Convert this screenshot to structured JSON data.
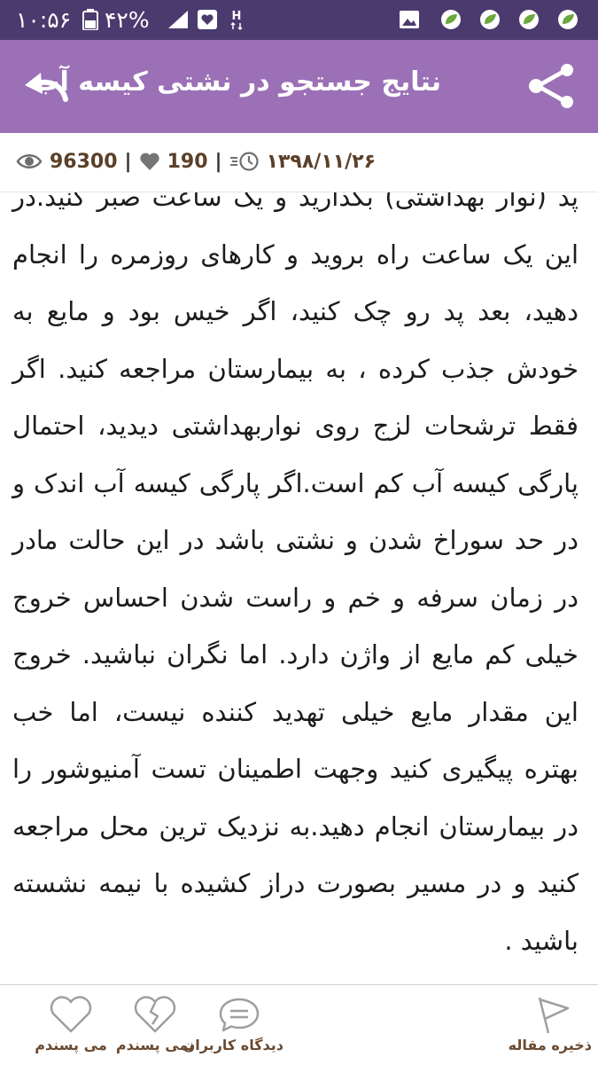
{
  "status_bar": {
    "time": "۱۰:۵۶",
    "battery_percent": "۴۲%",
    "icons": [
      "battery-icon",
      "signal-icon",
      "heart-app-icon",
      "data-h-icon",
      "image-icon",
      "app-leaf-icon"
    ]
  },
  "app_bar": {
    "title": "نتایج جستجو در نشتی کیسه آب",
    "background": "#9b70b7"
  },
  "meta": {
    "views": "96300",
    "likes": "190",
    "date": "۱۳۹۸/۱۱/۲۶",
    "separator": "|"
  },
  "article": {
    "text": "پد (نوار بهداشتی) بگذارید و یک ساعت صبر کنید.در این یک ساعت راه بروید و کارهای روزمره را انجام دهید، بعد پد رو چک کنید، اگر خیس بود و مایع به خودش جذب کرده ، به بیمارستان مراجعه کنید. اگر فقط ترشحات لزج روی نواربهداشتی دیدید، احتمال پارگی کیسه آب کم است.اگر پارگی کیسه آب اندک و در حد سوراخ شدن و نشتی باشد در این حالت مادر در زمان سرفه و خم و راست شدن احساس خروج خیلی کم مایع از واژن دارد. اما نگران نباشید. خروج این مقدار مایع خیلی تهدید کننده نیست، اما خب بهتره پیگیری کنید وجهت اطمینان تست آمنیوشور را در بیمارستان انجام دهید.به نزدیک ترین محل مراجعه کنید و در مسیر بصورت دراز کشیده با نیمه نشسته باشید ."
  },
  "bottom_bar": {
    "like_label": "می پسندم",
    "dislike_label": "نمی پسندم",
    "comments_label": "دیدگاه کاربران",
    "save_label": "ذخیره مقاله"
  }
}
